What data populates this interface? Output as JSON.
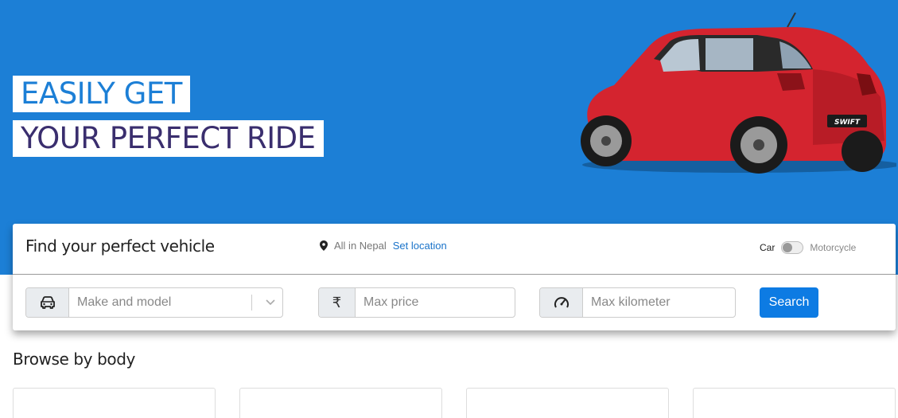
{
  "hero": {
    "line1": "EASILY GET",
    "line2": "YOUR PERFECT RIDE",
    "background_color": "#1c7fd6"
  },
  "search_panel": {
    "title": "Find your perfect vehicle",
    "location_icon": "map-pin-icon",
    "location_text": "All in Nepal",
    "set_location_label": "Set location",
    "vehicle_type": {
      "car_label": "Car",
      "motorcycle_label": "Motorcycle",
      "selected": "Car"
    },
    "make_model": {
      "icon": "car-icon",
      "placeholder": "Make and model"
    },
    "max_price": {
      "icon": "rupee-icon",
      "symbol": "₹",
      "placeholder": "Max price"
    },
    "max_km": {
      "icon": "speedometer-icon",
      "placeholder": "Max kilometer"
    },
    "search_label": "Search"
  },
  "browse": {
    "title": "Browse by body",
    "cards": [
      "",
      "",
      "",
      ""
    ]
  },
  "car_image": {
    "badge": "SWIFT",
    "color": "#d4242f"
  }
}
